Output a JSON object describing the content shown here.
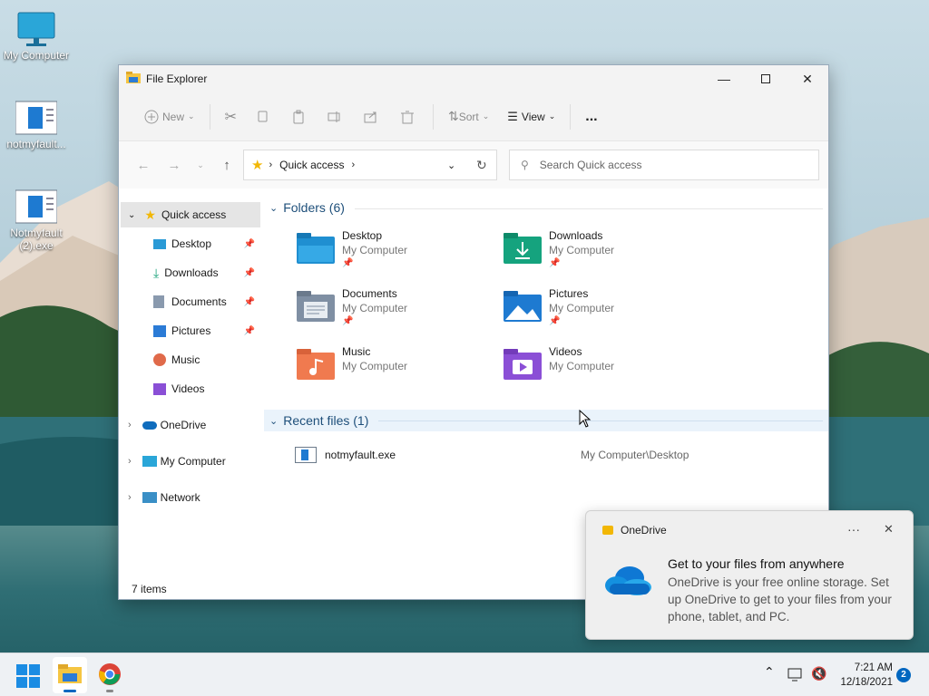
{
  "desktop": {
    "icons": [
      {
        "label": "My Computer"
      },
      {
        "label": "notmyfault..."
      },
      {
        "label": "Notmyfault (2).exe"
      }
    ]
  },
  "window": {
    "title": "File Explorer",
    "toolbar": {
      "new": "New",
      "sort": "Sort",
      "view": "View",
      "more": "..."
    },
    "address": {
      "location": "Quick access"
    },
    "search": {
      "placeholder": "Search Quick access"
    },
    "sidebar": {
      "quick_access": "Quick access",
      "items": [
        {
          "label": "Desktop",
          "pinned": true
        },
        {
          "label": "Downloads",
          "pinned": true
        },
        {
          "label": "Documents",
          "pinned": true
        },
        {
          "label": "Pictures",
          "pinned": true
        },
        {
          "label": "Music",
          "pinned": false
        },
        {
          "label": "Videos",
          "pinned": false
        }
      ],
      "onedrive": "OneDrive",
      "my_computer": "My Computer",
      "network": "Network"
    },
    "folders_header": "Folders (6)",
    "folders": [
      {
        "name": "Desktop",
        "location": "My Computer",
        "pinned": true
      },
      {
        "name": "Downloads",
        "location": "My Computer",
        "pinned": true
      },
      {
        "name": "Documents",
        "location": "My Computer",
        "pinned": true
      },
      {
        "name": "Pictures",
        "location": "My Computer",
        "pinned": true
      },
      {
        "name": "Music",
        "location": "My Computer",
        "pinned": false
      },
      {
        "name": "Videos",
        "location": "My Computer",
        "pinned": false
      }
    ],
    "recent_header": "Recent files (1)",
    "recent": [
      {
        "name": "notmyfault.exe",
        "path": "My Computer\\Desktop"
      }
    ],
    "status": "7 items"
  },
  "toast": {
    "app": "OneDrive",
    "more": "···",
    "heading": "Get to your files from anywhere",
    "body": "OneDrive is your free online storage. Set up OneDrive to get to your files from your phone, tablet, and PC."
  },
  "taskbar": {
    "time": "7:21 AM",
    "date": "12/18/2021",
    "notifications": "2"
  },
  "colors": {
    "accent": "#0067c0",
    "folder_yellow": "#f5c542",
    "section_blue": "#1e4f7a"
  }
}
